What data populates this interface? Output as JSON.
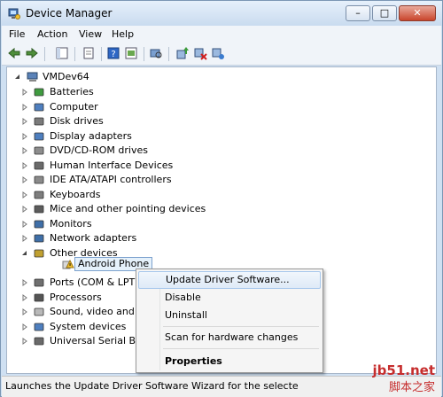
{
  "window": {
    "title": "Device Manager",
    "caption_buttons": {
      "minimize": "–",
      "maximize": "□",
      "close": "✕"
    }
  },
  "menubar": [
    "File",
    "Action",
    "View",
    "Help"
  ],
  "toolbar_icons": [
    "back-arrow-icon",
    "forward-arrow-icon",
    "show-hide-console-tree-icon",
    "properties-icon",
    "help-icon",
    "view-icon",
    "scan-hardware-icon",
    "update-driver-icon",
    "uninstall-icon",
    "enable-icon"
  ],
  "tree": {
    "root": "VMDev64",
    "categories": [
      "Batteries",
      "Computer",
      "Disk drives",
      "Display adapters",
      "DVD/CD-ROM drives",
      "Human Interface Devices",
      "IDE ATA/ATAPI controllers",
      "Keyboards",
      "Mice and other pointing devices",
      "Monitors",
      "Network adapters",
      "Other devices",
      "Ports (COM & LPT",
      "Processors",
      "Sound, video and",
      "System devices",
      "Universal Serial Bu"
    ],
    "child_of_other_devices": "Android Phone"
  },
  "context_menu": {
    "items": [
      "Update Driver Software...",
      "Disable",
      "Uninstall",
      "Scan for hardware changes",
      "Properties"
    ],
    "highlighted": "Update Driver Software..."
  },
  "status": "Launches the Update Driver Software Wizard for the selecte",
  "watermark": {
    "line1": "jb51.net",
    "line2": "脚本之家"
  }
}
